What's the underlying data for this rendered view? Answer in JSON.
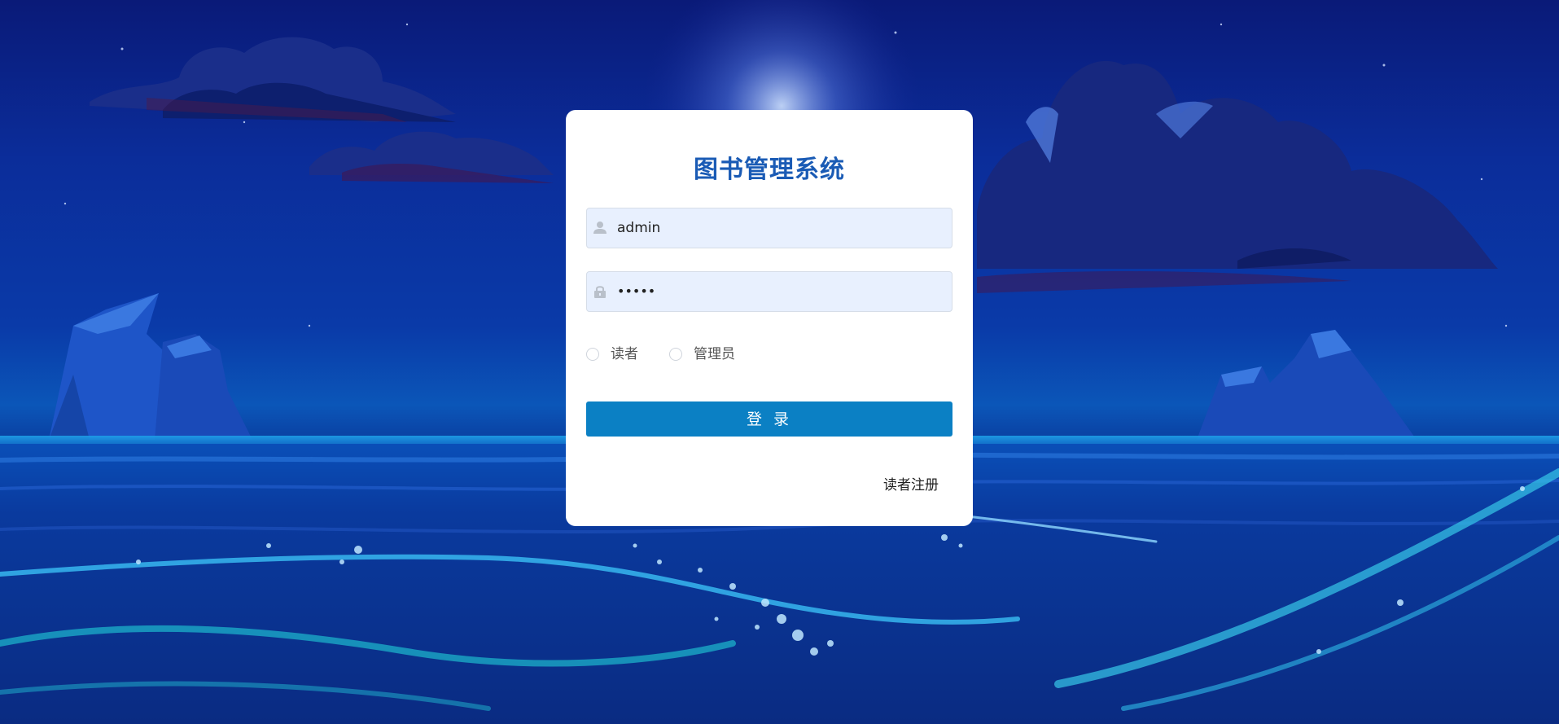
{
  "app": {
    "title": "图书管理系统"
  },
  "form": {
    "username_value": "admin",
    "password_value": "•••••",
    "roles": [
      {
        "label": "读者",
        "checked": false
      },
      {
        "label": "管理员",
        "checked": false
      }
    ],
    "login_label": "登 录",
    "register_label": "读者注册"
  },
  "icons": {
    "username": "user-icon",
    "password": "lock-icon"
  },
  "colors": {
    "title": "#1a5bb5",
    "button": "#0b80c4",
    "input_bg": "#e8f0fe",
    "card_bg": "#ffffff"
  }
}
